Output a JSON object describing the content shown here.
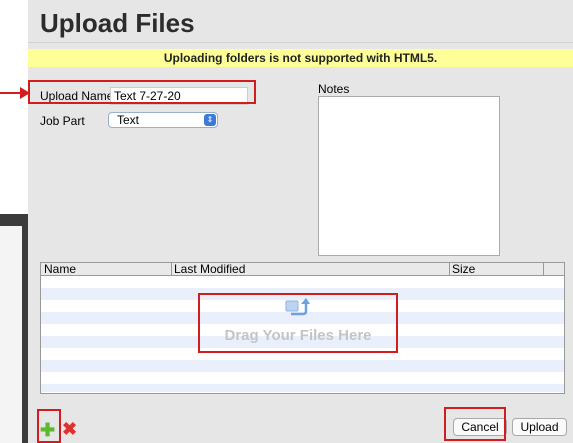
{
  "dialog": {
    "title": "Upload Files",
    "warning": "Uploading folders is not supported with HTML5."
  },
  "form": {
    "upload_name_label": "Upload Name",
    "upload_name_value": "Text 7-27-20",
    "job_part_label": "Job Part",
    "job_part_value": "Text",
    "notes_label": "Notes",
    "notes_value": ""
  },
  "file_table": {
    "columns": [
      "Name",
      "Last Modified",
      "Size"
    ],
    "drop_hint": "Drag Your Files Here",
    "rows": []
  },
  "footer": {
    "add_icon": "plus-icon",
    "remove_icon": "x-icon",
    "cancel_label": "Cancel",
    "upload_label": "Upload"
  },
  "colors": {
    "highlight": "#d11d1d",
    "warning_bg": "#ffff99",
    "stripe": "#eaf0fb"
  }
}
